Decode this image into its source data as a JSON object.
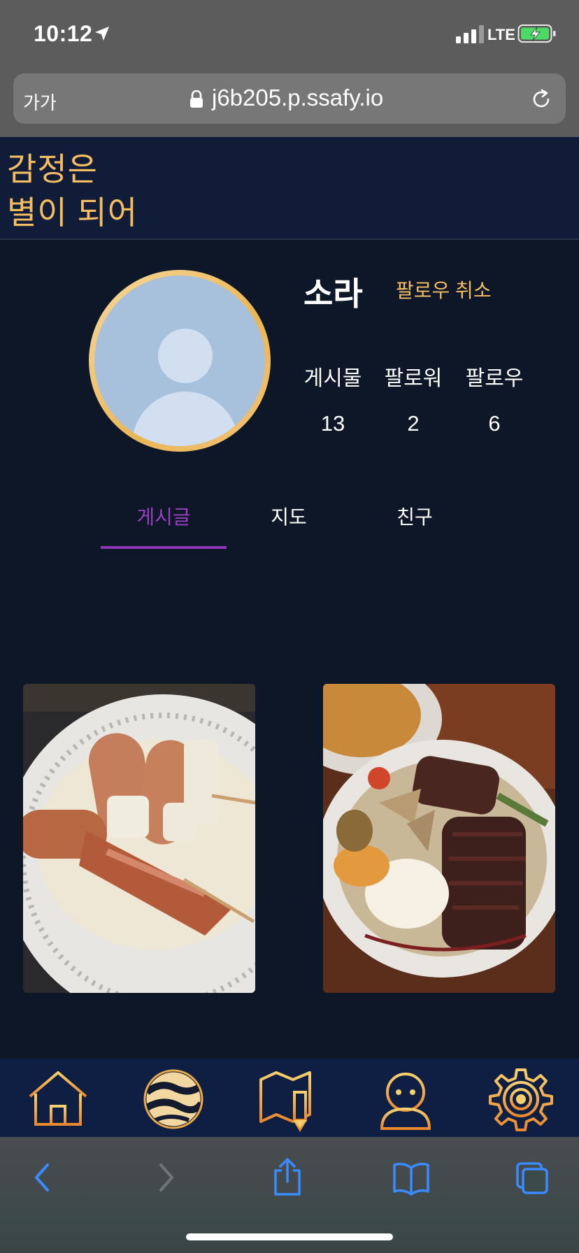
{
  "status_bar": {
    "time": "10:12",
    "network": "LTE"
  },
  "browser": {
    "text_size_label": "가가",
    "url": "j6b205.p.ssafy.io"
  },
  "app": {
    "logo_line1": "감정은",
    "logo_line2": "별이 되어"
  },
  "profile": {
    "username": "소라",
    "unfollow_label": "팔로우 취소",
    "stats": [
      {
        "label": "게시물",
        "value": "13"
      },
      {
        "label": "팔로워",
        "value": "2"
      },
      {
        "label": "팔로우",
        "value": "6"
      }
    ]
  },
  "tabs": [
    {
      "label": "게시글",
      "active": true
    },
    {
      "label": "지도",
      "active": false
    },
    {
      "label": "친구",
      "active": false
    }
  ],
  "posts": [
    {
      "image": "skewers-on-plate-photo"
    },
    {
      "image": "steak-plate-photo"
    }
  ],
  "bottom_nav": [
    {
      "icon": "home-icon"
    },
    {
      "icon": "planet-icon"
    },
    {
      "icon": "map-pencil-icon"
    },
    {
      "icon": "profile-icon"
    },
    {
      "icon": "settings-gear-icon"
    }
  ],
  "colors": {
    "accent_gold": "#f4bd62",
    "active_tab": "#9b3fc4",
    "background": "#0e1728",
    "header_bg": "#111d38",
    "nav_bg": "#0f1f44"
  }
}
